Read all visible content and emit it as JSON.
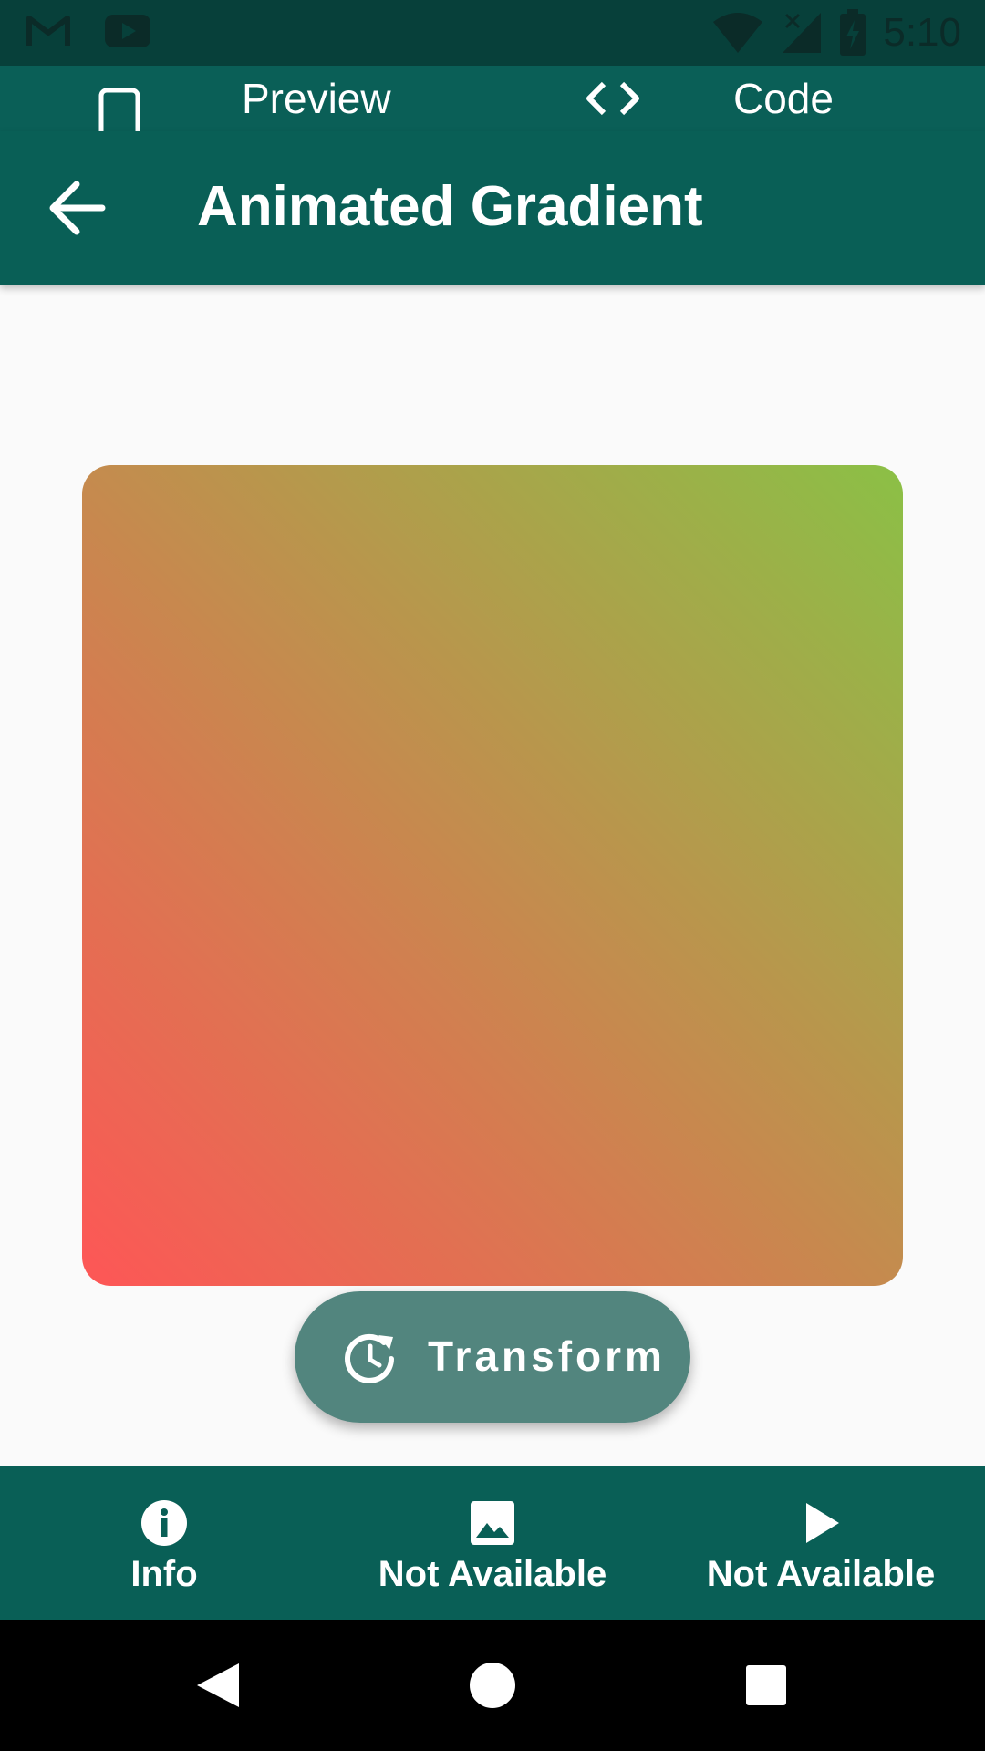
{
  "status_bar": {
    "time": "5:10",
    "icons": [
      "gmail-icon",
      "youtube-icon",
      "wifi-icon",
      "signal-icon",
      "battery-charging-icon"
    ]
  },
  "tabs": {
    "preview_label": "Preview",
    "code_label": "Code"
  },
  "app_bar": {
    "title": "Animated Gradient"
  },
  "gradient": {
    "color_start": "#fe5656",
    "color_end": "#8bc046"
  },
  "action": {
    "transform_label": "Transform"
  },
  "bottom_nav": {
    "items": [
      {
        "label": "Info",
        "icon": "info-icon"
      },
      {
        "label": "Not Available",
        "icon": "image-icon"
      },
      {
        "label": "Not Available",
        "icon": "play-icon"
      }
    ]
  },
  "colors": {
    "primary": "#095f56",
    "status_bar": "#07403a",
    "button": "#52857e",
    "background": "#fafafa"
  }
}
